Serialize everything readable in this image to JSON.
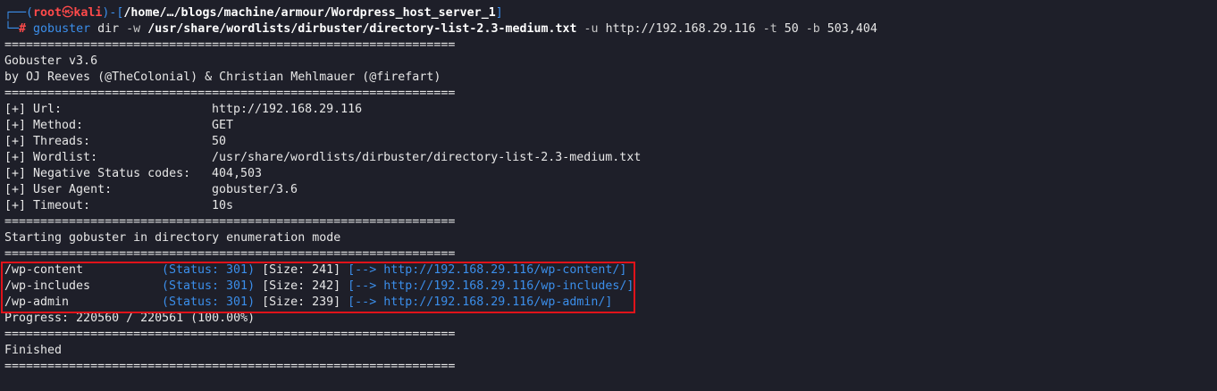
{
  "prompt": {
    "corner_top": "┌──(",
    "user": "root",
    "skull": "㉿",
    "host": "kali",
    "mid": ")-[",
    "cwd": "/home/…/blogs/machine/armour/Wordpress_host_server_1",
    "close": "]",
    "corner_bottom": "└─",
    "hash": "#"
  },
  "command": {
    "bin": "gobuster",
    "sub": "dir",
    "flag_w": "-w",
    "wordlist": "/usr/share/wordlists/dirbuster/directory-list-2.3-medium.txt",
    "flag_u": "-u",
    "url": "http://192.168.29.116",
    "flag_t": "-t",
    "threads": "50",
    "flag_b": "-b",
    "blacklist": "503,404"
  },
  "separator": "===============================================================",
  "banner": {
    "version": "Gobuster v3.6",
    "authors": "by OJ Reeves (@TheColonial) & Christian Mehlmauer (@firefart)"
  },
  "config": [
    {
      "label": "[+] Url:",
      "value": "http://192.168.29.116"
    },
    {
      "label": "[+] Method:",
      "value": "GET"
    },
    {
      "label": "[+] Threads:",
      "value": "50"
    },
    {
      "label": "[+] Wordlist:",
      "value": "/usr/share/wordlists/dirbuster/directory-list-2.3-medium.txt"
    },
    {
      "label": "[+] Negative Status codes:",
      "value": "404,503"
    },
    {
      "label": "[+] User Agent:",
      "value": "gobuster/3.6"
    },
    {
      "label": "[+] Timeout:",
      "value": "10s"
    }
  ],
  "start_msg": "Starting gobuster in directory enumeration mode",
  "results": [
    {
      "path": "/wp-content",
      "status": "(Status: 301)",
      "size": "[Size: 241]",
      "redirect": "[--> http://192.168.29.116/wp-content/]"
    },
    {
      "path": "/wp-includes",
      "status": "(Status: 301)",
      "size": "[Size: 242]",
      "redirect": "[--> http://192.168.29.116/wp-includes/]"
    },
    {
      "path": "/wp-admin",
      "status": "(Status: 301)",
      "size": "[Size: 239]",
      "redirect": "[--> http://192.168.29.116/wp-admin/]"
    }
  ],
  "progress": "Progress: 220560 / 220561 (100.00%)",
  "finished": "Finished",
  "colors": {
    "background": "#1e1f29",
    "prompt_blue": "#3b8eea",
    "prompt_red": "#ff4a4a",
    "highlight_box": "#e0131a"
  }
}
